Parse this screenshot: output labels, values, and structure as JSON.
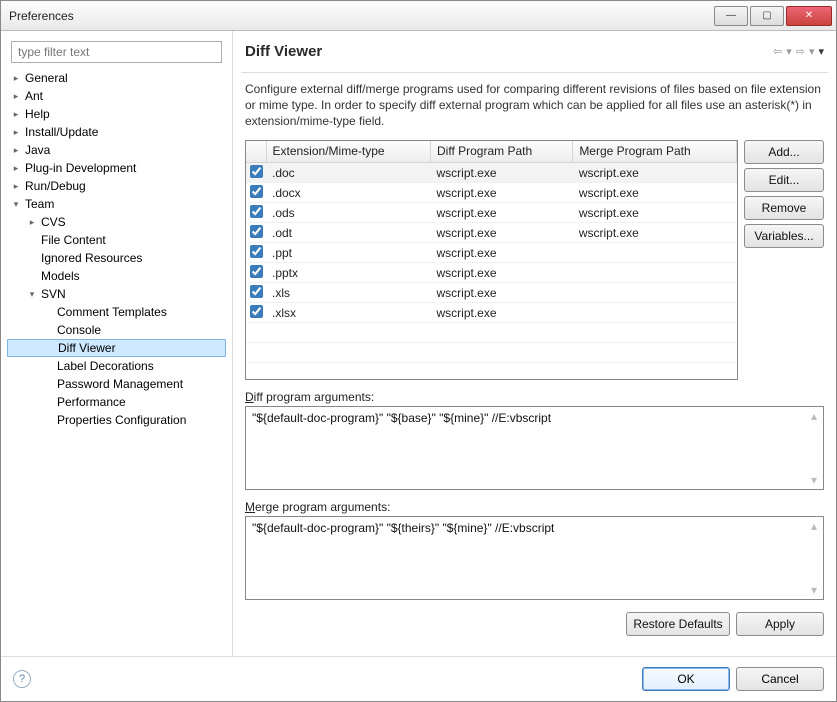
{
  "window": {
    "title": "Preferences"
  },
  "filter": {
    "placeholder": "type filter text"
  },
  "tree": {
    "items": [
      {
        "label": "General",
        "leaf": false,
        "expanded": false
      },
      {
        "label": "Ant",
        "leaf": false,
        "expanded": false
      },
      {
        "label": "Help",
        "leaf": false,
        "expanded": false
      },
      {
        "label": "Install/Update",
        "leaf": false,
        "expanded": false
      },
      {
        "label": "Java",
        "leaf": false,
        "expanded": false
      },
      {
        "label": "Plug-in Development",
        "leaf": false,
        "expanded": false
      },
      {
        "label": "Run/Debug",
        "leaf": false,
        "expanded": false
      }
    ],
    "team": {
      "label": "Team",
      "children": [
        {
          "label": "CVS",
          "leaf": false,
          "expanded": false
        },
        {
          "label": "File Content",
          "leaf": true
        },
        {
          "label": "Ignored Resources",
          "leaf": true
        },
        {
          "label": "Models",
          "leaf": true
        }
      ],
      "svn": {
        "label": "SVN",
        "children": [
          {
            "label": "Comment Templates"
          },
          {
            "label": "Console"
          },
          {
            "label": "Diff Viewer"
          },
          {
            "label": "Label Decorations"
          },
          {
            "label": "Password Management"
          },
          {
            "label": "Performance"
          },
          {
            "label": "Properties Configuration"
          }
        ]
      }
    }
  },
  "page": {
    "title": "Diff Viewer",
    "description": "Configure external diff/merge programs used for comparing different revisions of files based on file extension or mime type. In order to specify diff external program which can be applied for all files use an asterisk(*) in extension/mime-type field.",
    "columns": {
      "ext": "Extension/Mime-type",
      "diff": "Diff Program Path",
      "merge": "Merge Program Path"
    },
    "rows": [
      {
        "checked": true,
        "ext": ".doc",
        "diff": "wscript.exe",
        "merge": "wscript.exe",
        "selected": true
      },
      {
        "checked": true,
        "ext": ".docx",
        "diff": "wscript.exe",
        "merge": "wscript.exe"
      },
      {
        "checked": true,
        "ext": ".ods",
        "diff": "wscript.exe",
        "merge": "wscript.exe"
      },
      {
        "checked": true,
        "ext": ".odt",
        "diff": "wscript.exe",
        "merge": "wscript.exe"
      },
      {
        "checked": true,
        "ext": ".ppt",
        "diff": "wscript.exe",
        "merge": ""
      },
      {
        "checked": true,
        "ext": ".pptx",
        "diff": "wscript.exe",
        "merge": ""
      },
      {
        "checked": true,
        "ext": ".xls",
        "diff": "wscript.exe",
        "merge": ""
      },
      {
        "checked": true,
        "ext": ".xlsx",
        "diff": "wscript.exe",
        "merge": ""
      }
    ],
    "buttons": {
      "add": "Add...",
      "edit": "Edit...",
      "remove": "Remove",
      "variables": "Variables..."
    },
    "diffArgs": {
      "label_pre": "D",
      "label_post": "iff program arguments:",
      "value": "\"${default-doc-program}\" \"${base}\" \"${mine}\" //E:vbscript"
    },
    "mergeArgs": {
      "label_pre": "M",
      "label_post": "erge program arguments:",
      "value": "\"${default-doc-program}\" \"${theirs}\" \"${mine}\" //E:vbscript"
    },
    "restore": "Restore Defaults",
    "apply": "Apply"
  },
  "footer": {
    "ok": "OK",
    "cancel": "Cancel"
  }
}
